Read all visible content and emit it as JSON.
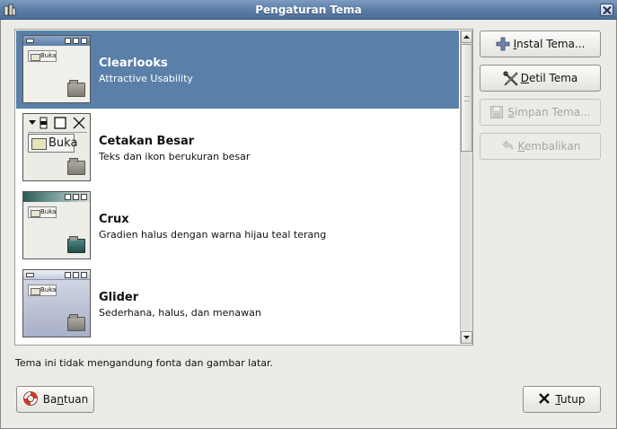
{
  "window": {
    "title": "Pengaturan Tema",
    "menu_icon": "window-menu-icon",
    "close_icon": "close-icon"
  },
  "themes": [
    {
      "name": "Clearlooks",
      "description": "Attractive Usability",
      "selected": true,
      "preview_button": "Buka"
    },
    {
      "name": "Cetakan Besar",
      "description": "Teks dan ikon berukuran besar",
      "selected": false,
      "preview_button": "Buka"
    },
    {
      "name": "Crux",
      "description": "Gradien halus dengan warna hijau teal terang",
      "selected": false,
      "preview_button": "Buka"
    },
    {
      "name": "Glider",
      "description": "Sederhana, halus, dan menawan",
      "selected": false,
      "preview_button": "Buka"
    }
  ],
  "side_buttons": {
    "install": {
      "before": "",
      "mnemonic": "I",
      "after": "nstal Tema...",
      "icon": "plus-icon",
      "enabled": true
    },
    "details": {
      "before": "",
      "mnemonic": "D",
      "after": "etil Tema",
      "icon": "tools-icon",
      "enabled": true
    },
    "save": {
      "before": "",
      "mnemonic": "S",
      "after": "impan Tema...",
      "icon": "floppy-icon",
      "enabled": false
    },
    "revert": {
      "before": "",
      "mnemonic": "K",
      "after": "embalikan",
      "icon": "undo-icon",
      "enabled": false
    }
  },
  "status": "Tema ini tidak mengandung fonta dan gambar latar.",
  "bottom_buttons": {
    "help": {
      "before": "Ba",
      "mnemonic": "n",
      "after": "tuan",
      "icon": "lifebuoy-icon"
    },
    "close": {
      "before": "",
      "mnemonic": "T",
      "after": "utup",
      "icon": "x-icon"
    }
  },
  "colors": {
    "selection": "#5a80aa",
    "titlebar": "#5a7ba4",
    "background": "#ecebe6"
  }
}
